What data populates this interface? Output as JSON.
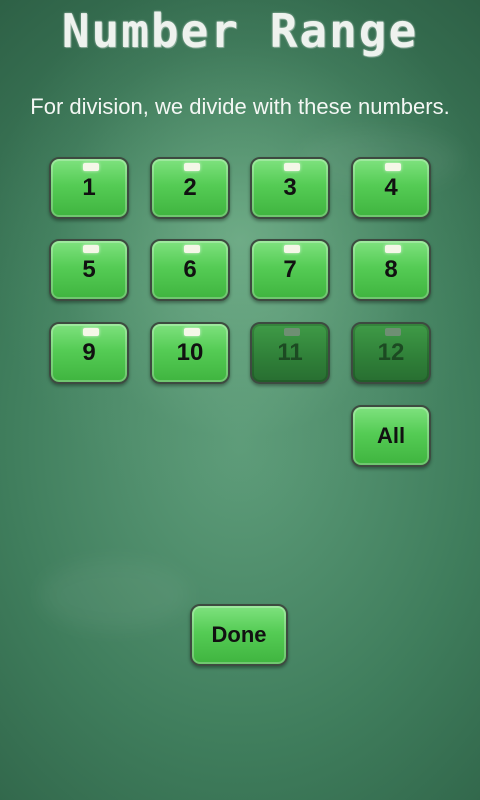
{
  "title": "Number Range",
  "subtitle": "For division, we divide with these numbers.",
  "numbers": [
    {
      "label": "1",
      "selected": true
    },
    {
      "label": "2",
      "selected": true
    },
    {
      "label": "3",
      "selected": true
    },
    {
      "label": "4",
      "selected": true
    },
    {
      "label": "5",
      "selected": true
    },
    {
      "label": "6",
      "selected": true
    },
    {
      "label": "7",
      "selected": true
    },
    {
      "label": "8",
      "selected": true
    },
    {
      "label": "9",
      "selected": true
    },
    {
      "label": "10",
      "selected": true
    },
    {
      "label": "11",
      "selected": false
    },
    {
      "label": "12",
      "selected": false
    }
  ],
  "all_label": "All",
  "done_label": "Done",
  "colors": {
    "selected_button": "#55cc55",
    "unselected_button": "#2f7f38",
    "chalkboard": "#3f7d5c"
  }
}
